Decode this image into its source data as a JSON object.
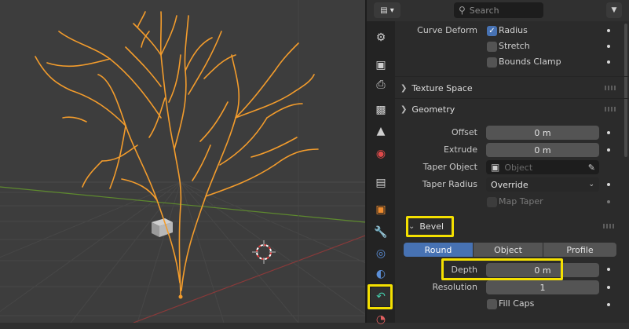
{
  "header": {
    "search_placeholder": "Search"
  },
  "icons": {
    "editor": "properties-icon",
    "search": "search-icon",
    "menu": "chevron-down-icon"
  },
  "tabs": [
    {
      "name": "tool-icon"
    },
    {
      "name": "render-icon"
    },
    {
      "name": "output-icon"
    },
    {
      "name": "view-layer-icon"
    },
    {
      "name": "scene-icon"
    },
    {
      "name": "world-icon"
    },
    {
      "name": "collection-icon"
    },
    {
      "name": "object-icon"
    },
    {
      "name": "modifier-icon"
    },
    {
      "name": "particles-icon"
    },
    {
      "name": "physics-icon"
    },
    {
      "name": "curve-data-icon"
    },
    {
      "name": "material-icon"
    }
  ],
  "curve_deform": {
    "label": "Curve Deform",
    "radius": {
      "label": "Radius",
      "checked": true
    },
    "stretch": {
      "label": "Stretch",
      "checked": false
    },
    "bounds_clamp": {
      "label": "Bounds Clamp",
      "checked": false
    }
  },
  "texture_space": {
    "title": "Texture Space",
    "expanded": false
  },
  "geometry": {
    "title": "Geometry",
    "expanded": true,
    "offset": {
      "label": "Offset",
      "value": "0 m"
    },
    "extrude": {
      "label": "Extrude",
      "value": "0 m"
    },
    "taper_object": {
      "label": "Taper Object",
      "placeholder": "Object"
    },
    "taper_radius": {
      "label": "Taper Radius",
      "value": "Override"
    },
    "map_taper": {
      "label": "Map Taper",
      "checked": false
    }
  },
  "bevel": {
    "title": "Bevel",
    "expanded": true,
    "modes": [
      "Round",
      "Object",
      "Profile"
    ],
    "active_mode": "Round",
    "depth": {
      "label": "Depth",
      "value": "0 m"
    },
    "resolution": {
      "label": "Resolution",
      "value": "1"
    },
    "fill_caps": {
      "label": "Fill Caps",
      "checked": false
    }
  },
  "colors": {
    "accent": "#4772b3",
    "highlight": "#f4e000",
    "curve": "#f39c2c"
  }
}
